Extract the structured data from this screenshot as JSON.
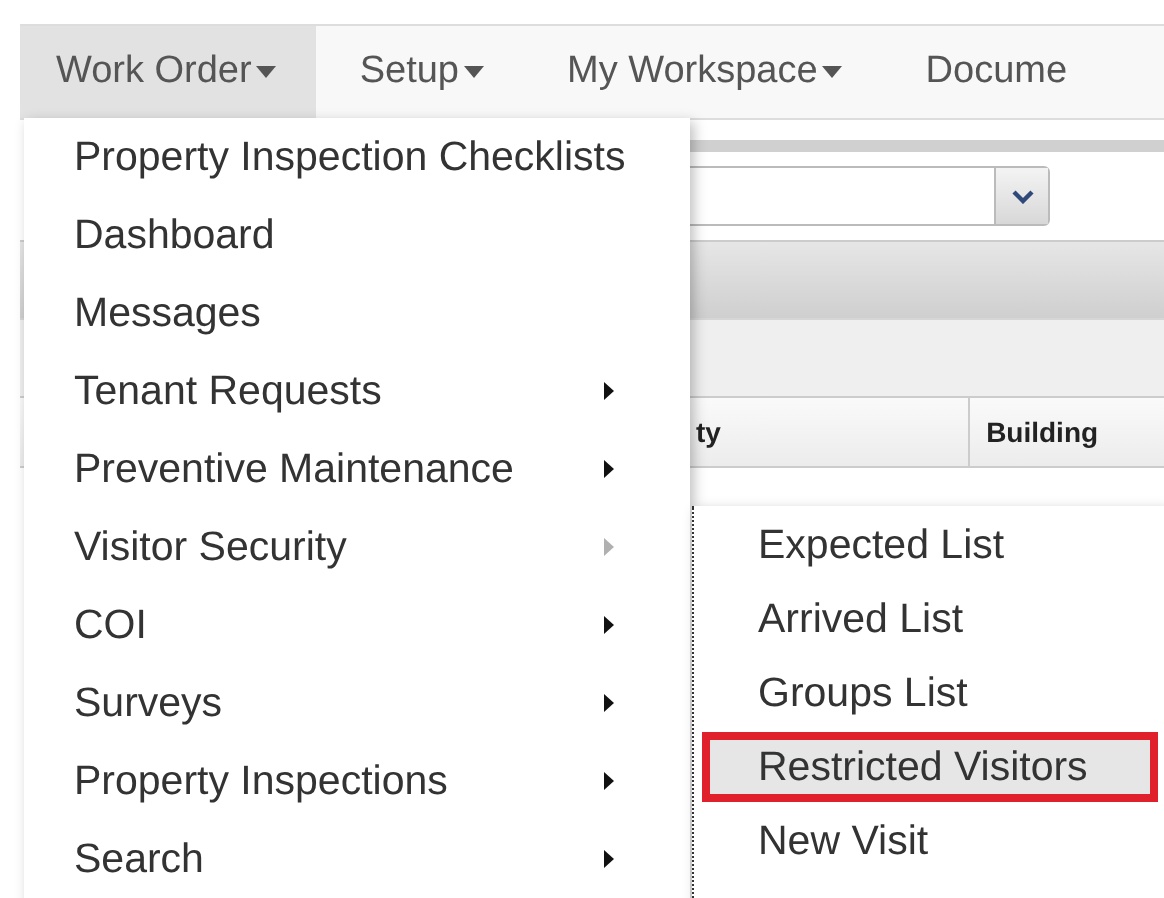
{
  "nav": [
    {
      "label": "Work Order",
      "selected": true,
      "caret": true
    },
    {
      "label": "Setup",
      "selected": false,
      "caret": true
    },
    {
      "label": "My Workspace",
      "selected": false,
      "caret": true
    },
    {
      "label": "Docume",
      "selected": false,
      "caret": false
    }
  ],
  "menu": [
    {
      "label": "Property Inspection Checklists"
    },
    {
      "label": "Dashboard"
    },
    {
      "label": "Messages"
    },
    {
      "label": "Tenant Requests",
      "submenu": true,
      "expanded": false
    },
    {
      "label": "Preventive Maintenance",
      "submenu": true,
      "expanded": false
    },
    {
      "label": "Visitor Security",
      "submenu": true,
      "expanded": true
    },
    {
      "label": "COI",
      "submenu": true,
      "expanded": false
    },
    {
      "label": "Surveys",
      "submenu": true,
      "expanded": false
    },
    {
      "label": "Property Inspections",
      "submenu": true,
      "expanded": false
    },
    {
      "label": "Search",
      "submenu": true,
      "expanded": false
    }
  ],
  "submenu": [
    {
      "label": "Expected List",
      "selected": false
    },
    {
      "label": "Arrived List",
      "selected": false
    },
    {
      "label": "Groups List",
      "selected": false
    },
    {
      "label": "Restricted Visitors",
      "selected": true
    },
    {
      "label": "New Visit",
      "selected": false
    }
  ],
  "table": {
    "columns": [
      "ty",
      "Building"
    ]
  }
}
